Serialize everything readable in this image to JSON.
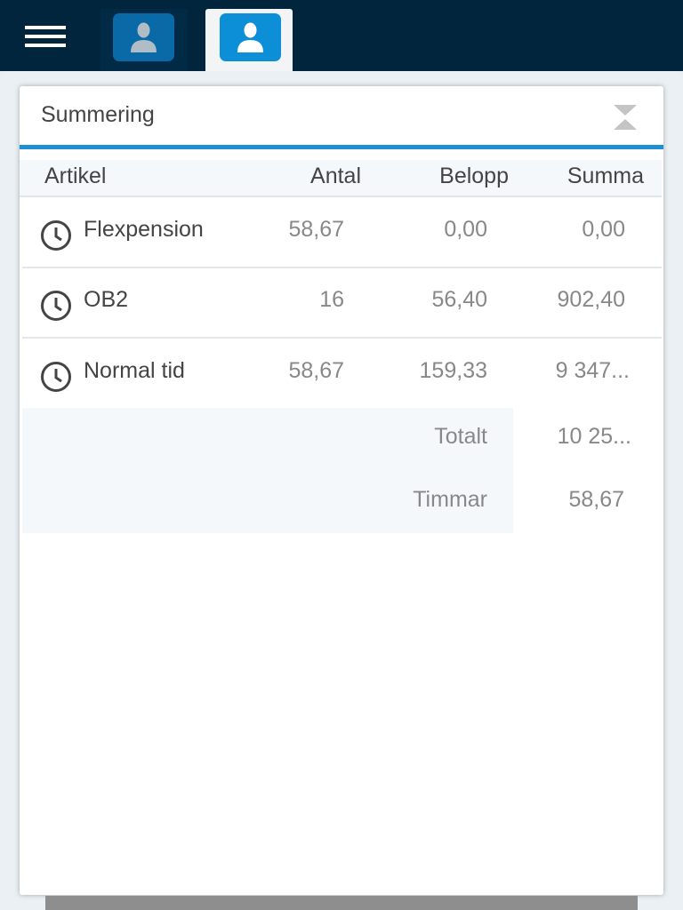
{
  "panel": {
    "title": "Summering"
  },
  "table": {
    "headers": [
      "Artikel",
      "Antal",
      "Belopp",
      "Summa"
    ],
    "rows": [
      {
        "artikel": "Flexpension",
        "antal": "58,67",
        "belopp": "0,00",
        "summa": "0,00"
      },
      {
        "artikel": "OB2",
        "antal": "16",
        "belopp": "56,40",
        "summa": "902,40"
      },
      {
        "artikel": "Normal tid",
        "antal": "58,67",
        "belopp": "159,33",
        "summa": "9 347..."
      }
    ],
    "totals": [
      {
        "label": "Totalt",
        "value": "10 25..."
      },
      {
        "label": "Timmar",
        "value": "58,67"
      }
    ]
  },
  "colors": {
    "header": "#01253d",
    "accent": "#1e8fd5"
  }
}
